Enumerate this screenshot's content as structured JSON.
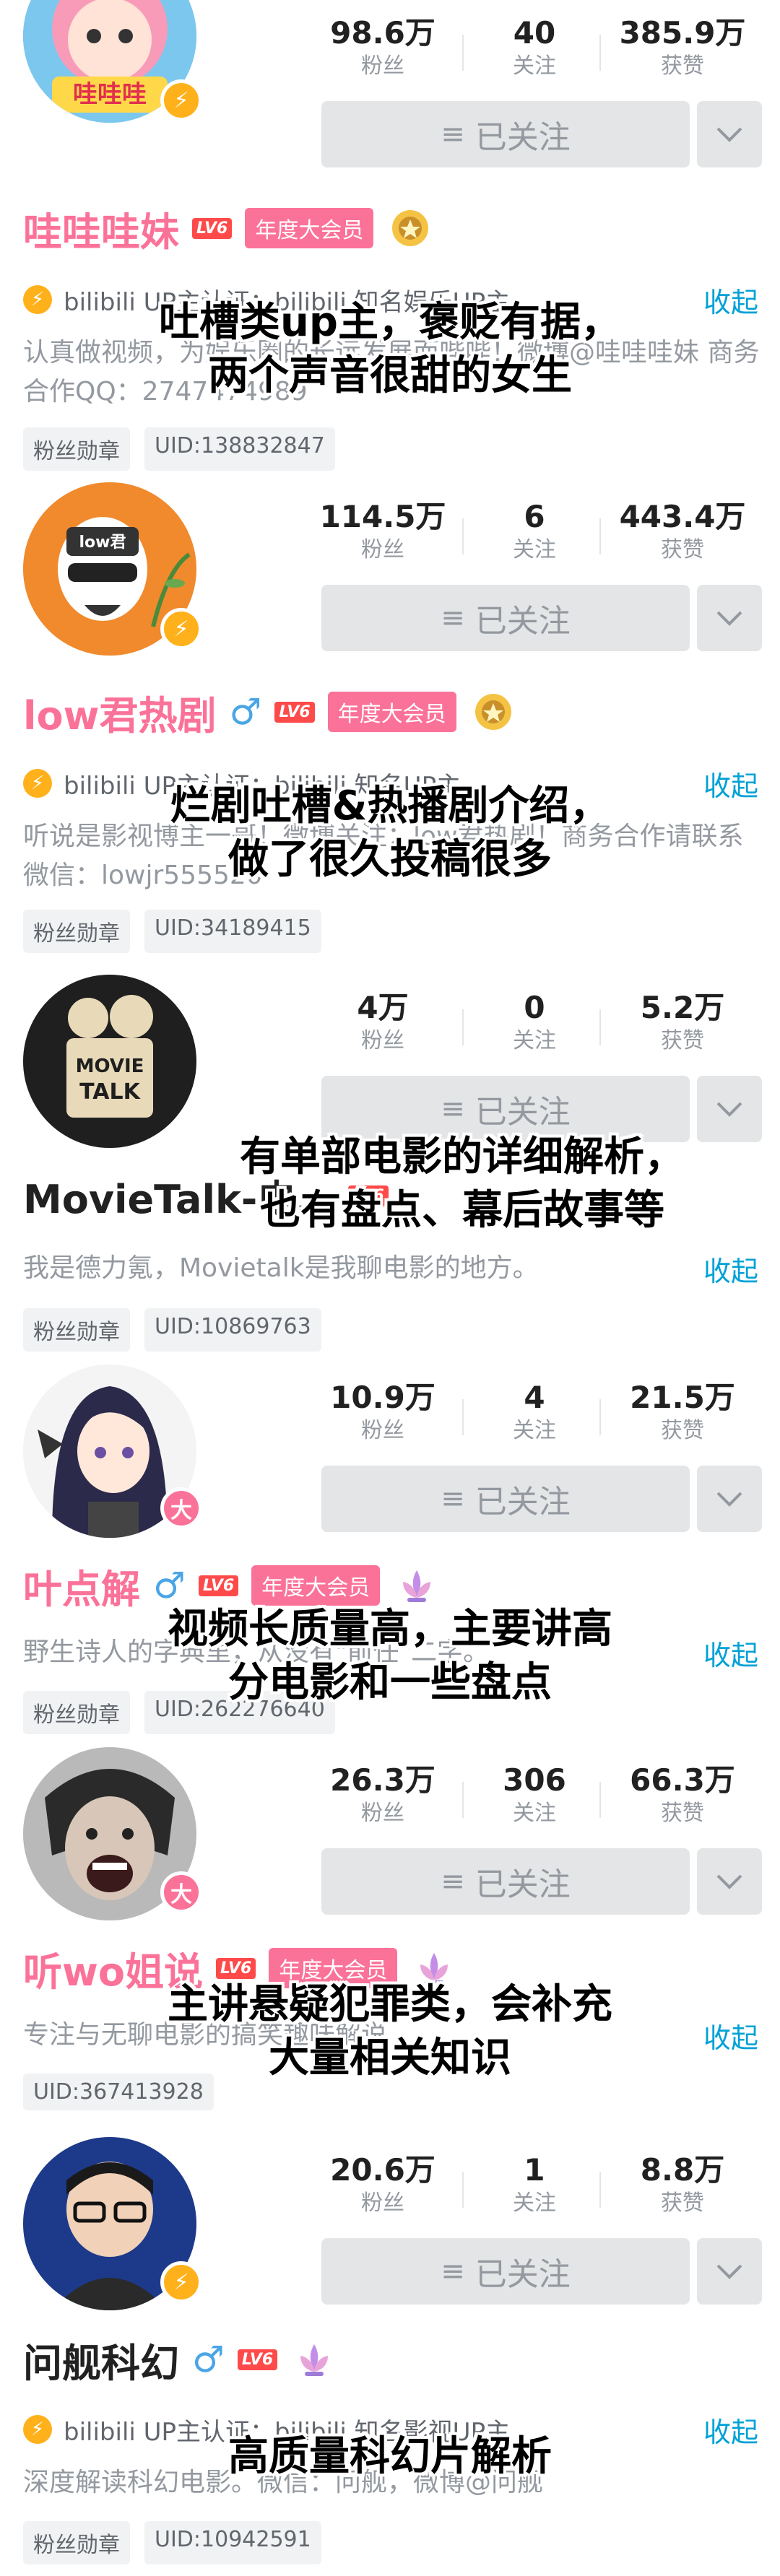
{
  "common": {
    "followers_label": "粉丝",
    "following_label": "关注",
    "likes_label": "获赞",
    "follow_button_label": "已关注",
    "collapse_label": "收起",
    "fans_medal_label": "粉丝勋章",
    "vip_label": "年度大会员",
    "level_label": "LV6",
    "male_symbol": "♂",
    "colors": {
      "pink": "#fb7299",
      "blue": "#00a1d6",
      "gold": "#ffb11b"
    }
  },
  "cards": [
    {
      "followers": "98.6万",
      "following": "40",
      "likes": "385.9万",
      "name": "哇哇哇妹",
      "verify": "bilibili UP主认证：bilibili 知名娱乐UP主",
      "bio": "认真做视频，为娱乐圈的长远发展而哔哔！微博@哇哇哇妹  商务合作QQ：2747474989",
      "uid": "UID:138832847",
      "overlay": [
        "吐槽类up主，褒贬有据，",
        "两个声音很甜的女生"
      ]
    },
    {
      "followers": "114.5万",
      "following": "6",
      "likes": "443.4万",
      "name": "low君热剧",
      "verify": "bilibili UP主认证：bilibili 知名UP主",
      "bio": "听说是影视博主一哥！微博关注：low君热剧！商务合作请联系 微信：lowjr555520",
      "uid": "UID:34189415",
      "overlay": [
        "烂剧吐槽&热播剧介绍，",
        "做了很久投稿很多"
      ]
    },
    {
      "followers": "4万",
      "following": "0",
      "likes": "5.2万",
      "name": "MovieTalk-电…",
      "bio": "我是德力氪，Movietalk是我聊电影的地方。",
      "uid": "UID:10869763",
      "overlay": [
        "有单部电影的详细解析，",
        "也有盘点、幕后故事等"
      ]
    },
    {
      "followers": "10.9万",
      "following": "4",
      "likes": "21.5万",
      "name": "叶点解",
      "bio": "野生诗人的字典里，从没有\"前任\"二字。",
      "uid": "UID:262276640",
      "overlay": [
        "视频长质量高，主要讲高",
        "分电影和一些盘点"
      ]
    },
    {
      "followers": "26.3万",
      "following": "306",
      "likes": "66.3万",
      "name": "听wo姐说",
      "bio": "专注与无聊电影的搞笑趣味解说",
      "uid": "UID:367413928",
      "overlay": [
        "主讲悬疑犯罪类，会补充",
        "大量相关知识"
      ]
    },
    {
      "followers": "20.6万",
      "following": "1",
      "likes": "8.8万",
      "name": "问舰科幻",
      "verify": "bilibili UP主认证：bilibili 知名影视UP主",
      "bio": "深度解读科幻电影。微信：问舰，微博@问舰",
      "uid": "UID:10942591",
      "overlay": [
        "高质量科幻片解析"
      ]
    }
  ],
  "avatars": {
    "card0_text": "哇哇哇",
    "card1_text": "low君",
    "card2_text": [
      "MOVIE",
      "TALK"
    ],
    "badge_da": "大"
  }
}
